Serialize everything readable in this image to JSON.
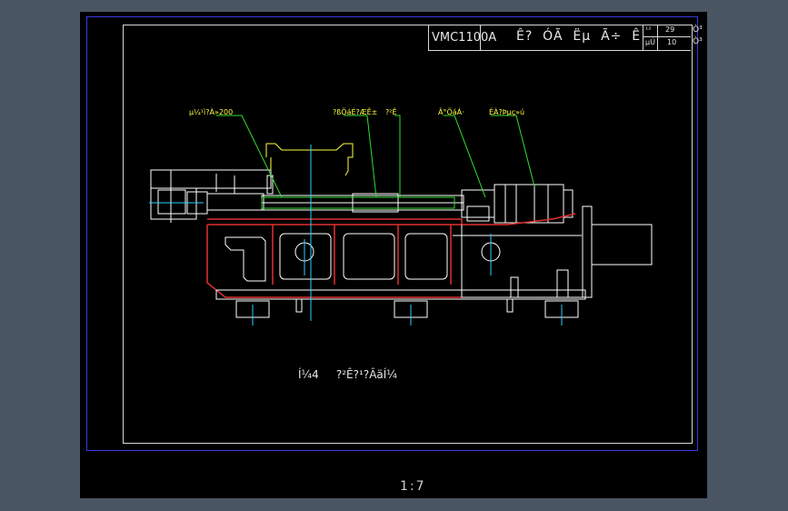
{
  "title_block": {
    "model": "VMC1100A",
    "drawing_name": "Ê?  ÓÃ  Ëµ  Ã÷  Ê",
    "cell_top_a": "¹²",
    "cell_top_b": "29",
    "cell_bottom_a": "µÚ",
    "cell_bottom_b": "10",
    "cell_right_top": "Ò³",
    "cell_right_bottom": "Ò³"
  },
  "callouts": [
    {
      "text": "µ¼¹ì?À»200"
    },
    {
      "text": "?ßÖáÉ?ÆÊ±"
    },
    {
      "text": "?²Ê"
    },
    {
      "text": "Â°ÖáÁ·"
    },
    {
      "text": "ÉÀ?Þµç»ú"
    }
  ],
  "caption": "Í¼4     ?²Ê?¹?ÂäÍ¼",
  "scale": "1:7",
  "colors": {
    "background": "#000000",
    "frame_outer": "#3a3ae0",
    "lines": "#ffffff",
    "casting": "#e03030",
    "centerline": "#30d0ff",
    "callout": "#ffff40",
    "leader": "#30e030"
  }
}
